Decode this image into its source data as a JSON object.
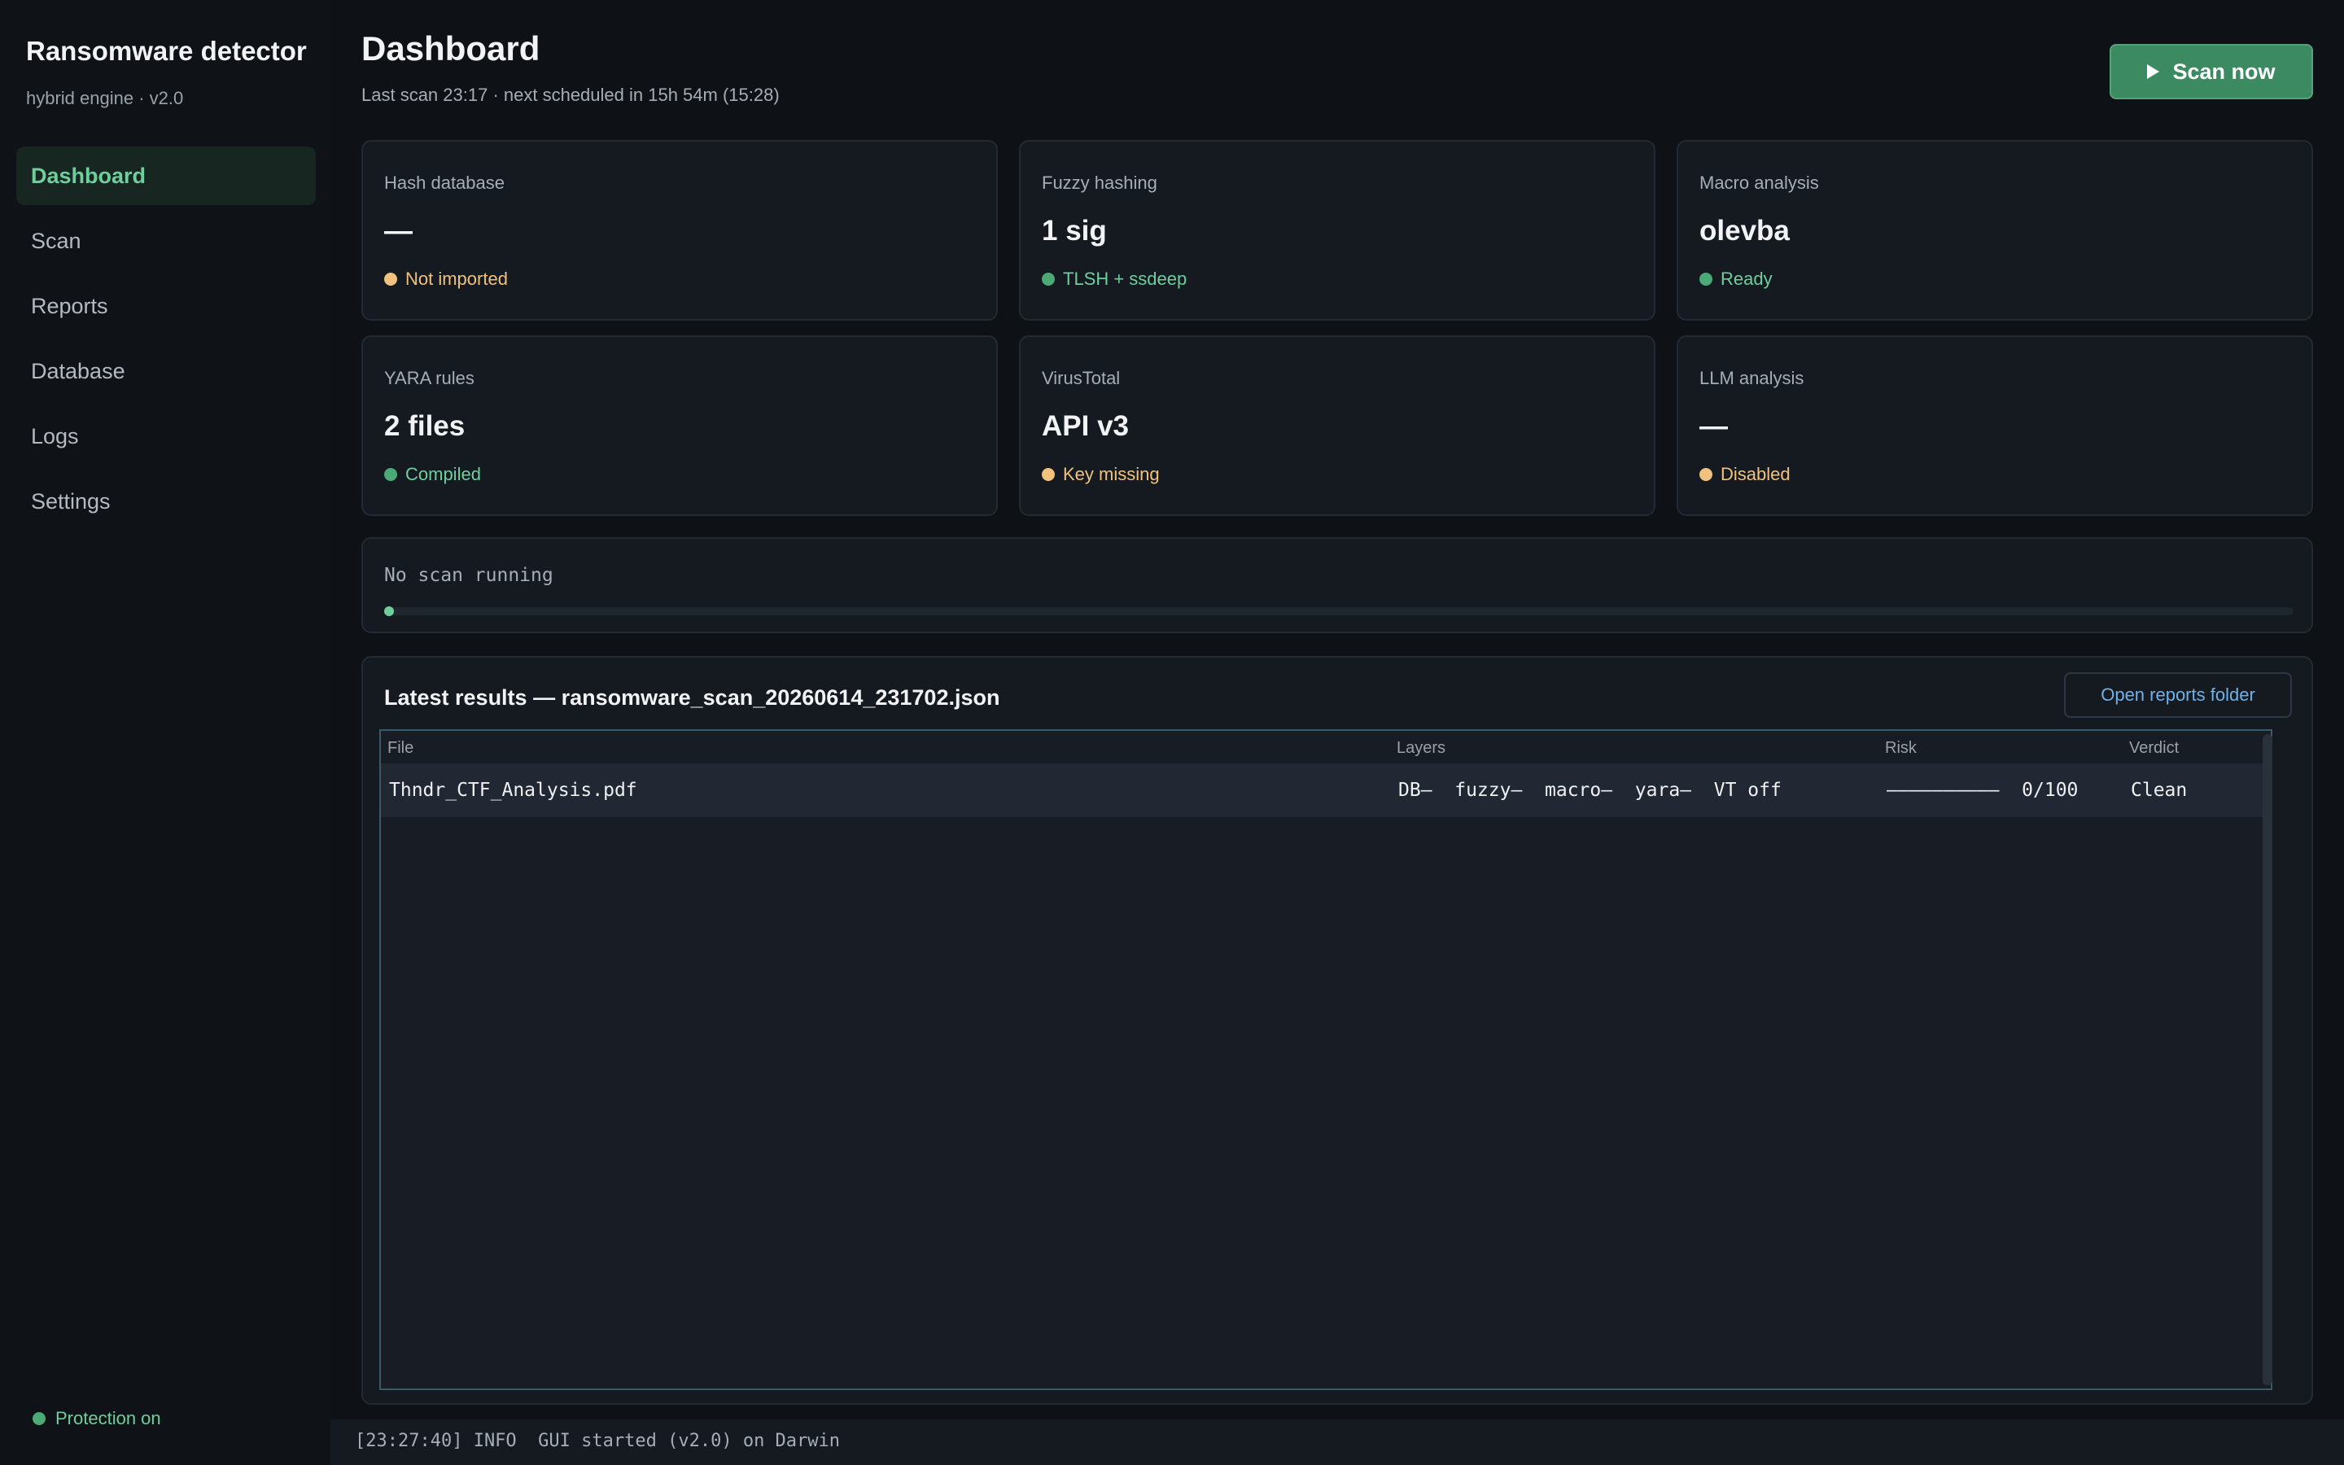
{
  "sidebar": {
    "title": "Ransomware detector",
    "subtitle": "hybrid engine · v2.0",
    "items": [
      {
        "label": "Dashboard",
        "active": true
      },
      {
        "label": "Scan"
      },
      {
        "label": "Reports"
      },
      {
        "label": "Database"
      },
      {
        "label": "Logs"
      },
      {
        "label": "Settings"
      }
    ],
    "protection": "Protection on"
  },
  "header": {
    "title": "Dashboard",
    "subtitle": "Last scan 23:17  ·  next scheduled in 15h 54m (15:28)",
    "scan_button": "Scan now"
  },
  "cards": [
    {
      "label": "Hash database",
      "value": "—",
      "status": "Not imported",
      "state": "warn"
    },
    {
      "label": "Fuzzy hashing",
      "value": "1 sig",
      "status": "TLSH + ssdeep",
      "state": "ok"
    },
    {
      "label": "Macro analysis",
      "value": "olevba",
      "status": "Ready",
      "state": "ok"
    },
    {
      "label": "YARA rules",
      "value": "2 files",
      "status": "Compiled",
      "state": "ok"
    },
    {
      "label": "VirusTotal",
      "value": "API v3",
      "status": "Key missing",
      "state": "warn"
    },
    {
      "label": "LLM analysis",
      "value": "—",
      "status": "Disabled",
      "state": "warn"
    }
  ],
  "progress": {
    "text": "No scan running",
    "fraction": 0
  },
  "results": {
    "title": "Latest results — ransomware_scan_20260614_231702.json",
    "open_button": "Open reports folder",
    "columns": [
      "File",
      "Layers",
      "Risk",
      "Verdict"
    ],
    "rows": [
      {
        "file": "Thndr_CTF_Analysis.pdf",
        "layers": "DB—  fuzzy—  macro—  yara—  VT off",
        "risk": "——————————  0/100",
        "verdict": "Clean"
      }
    ]
  },
  "log": "[23:27:40] INFO  GUI started (v2.0) on Darwin",
  "colors": {
    "accent": "#6ecf9c",
    "button": "#3c8a62",
    "warn": "#f1c27d",
    "link": "#6fb1e8"
  }
}
